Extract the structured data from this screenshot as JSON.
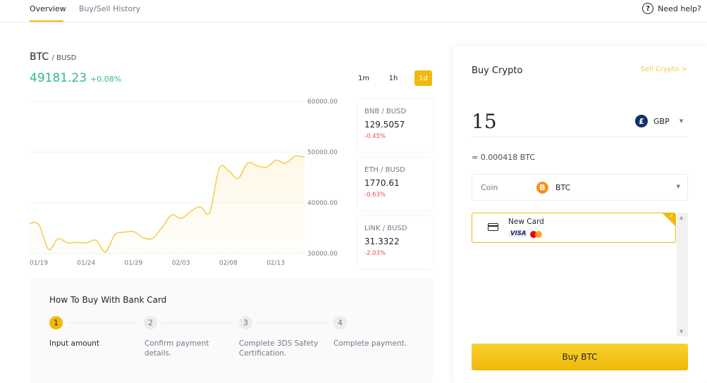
{
  "nav": {
    "tabs": [
      {
        "label": "Overview",
        "active": true
      },
      {
        "label": "Buy/Sell History",
        "active": false
      }
    ],
    "help_label": "Need help?",
    "help_icon": "question-circle-icon"
  },
  "market": {
    "base": "BTC",
    "quote": "/ BUSD",
    "price": "49181.23",
    "change": "+0.08%",
    "intervals": [
      {
        "label": "1m",
        "active": false
      },
      {
        "label": "1h",
        "active": false
      },
      {
        "label": "1d",
        "active": true
      }
    ]
  },
  "tickers": [
    {
      "pair": "BNB / BUSD",
      "price": "129.5057",
      "change": "-0.45%"
    },
    {
      "pair": "ETH / BUSD",
      "price": "1770.61",
      "change": "-0.63%"
    },
    {
      "pair": "LINK / BUSD",
      "price": "31.3322",
      "change": "-2.03%"
    }
  ],
  "chart_data": {
    "type": "area",
    "title": "BTC / BUSD",
    "xlabel": "",
    "ylabel": "",
    "x_tick_labels": [
      "01/19",
      "01/24",
      "01/29",
      "02/03",
      "02/08",
      "02/13"
    ],
    "y_tick_labels": [
      "60000.00",
      "50000.00",
      "40000.00",
      "30000.00"
    ],
    "ylim": [
      30000,
      60000
    ],
    "grid": true,
    "x": [
      "01/19",
      "01/20",
      "01/21",
      "01/22",
      "01/23",
      "01/24",
      "01/25",
      "01/26",
      "01/27",
      "01/28",
      "01/29",
      "01/30",
      "01/31",
      "02/01",
      "02/02",
      "02/03",
      "02/04",
      "02/05",
      "02/06",
      "02/07",
      "02/08",
      "02/09",
      "02/10",
      "02/11",
      "02/12",
      "02/13",
      "02/14",
      "02/15",
      "02/16",
      "02/17"
    ],
    "series": [
      {
        "name": "BTC/BUSD",
        "color": "#f0b90b",
        "values": [
          36000,
          35600,
          30800,
          32900,
          32100,
          32200,
          32100,
          32600,
          30300,
          33700,
          34200,
          34300,
          33100,
          33000,
          35200,
          37600,
          36900,
          38300,
          39200,
          38100,
          46800,
          46300,
          44800,
          47800,
          47300,
          47000,
          48400,
          47800,
          49200,
          49000
        ]
      }
    ]
  },
  "howto": {
    "title": "How To Buy With Bank Card",
    "steps": [
      {
        "num": "1",
        "label": "Input amount",
        "active": true
      },
      {
        "num": "2",
        "label": "Confirm payment details.",
        "active": false
      },
      {
        "num": "3",
        "label": "Complete 3DS Safety Certification.",
        "active": false
      },
      {
        "num": "4",
        "label": "Complete payment.",
        "active": false
      }
    ]
  },
  "buy_panel": {
    "title": "Buy Crypto",
    "sell_link": "Sell Crypto >",
    "amount": "15",
    "currency": "GBP",
    "currency_symbol": "£",
    "estimate": "≈ 0.000418 BTC",
    "coin_label": "Coin",
    "coin": "BTC",
    "coin_symbol": "B",
    "payment_method": {
      "name": "New Card",
      "brands": [
        "VISA",
        "Mastercard"
      ],
      "selected": true
    },
    "buy_button": "Buy BTC"
  },
  "colors": {
    "accent": "#f0b90b",
    "up": "#2ebd85",
    "down": "#f6465d"
  }
}
